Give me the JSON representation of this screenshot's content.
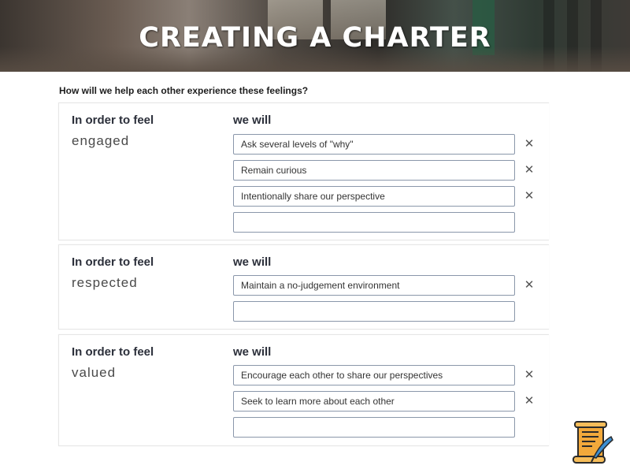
{
  "banner": {
    "title": "CREATING A CHARTER"
  },
  "question": "How will we help each other experience these feelings?",
  "cards": [
    {
      "feel_heading": "In order to feel",
      "feeling": "engaged",
      "will_heading": "we will",
      "entries": [
        "Ask several levels of \"why\"",
        "Remain curious",
        "Intentionally share our perspective",
        ""
      ]
    },
    {
      "feel_heading": "In order to feel",
      "feeling": "respected",
      "will_heading": "we will",
      "entries": [
        "Maintain a no-judgement environment",
        ""
      ]
    },
    {
      "feel_heading": "In order to feel",
      "feeling": "valued",
      "will_heading": "we will",
      "entries": [
        "Encourage each other to share our perspectives",
        "Seek to learn more about each other",
        ""
      ]
    }
  ],
  "icons": {
    "remove": "close-icon",
    "logo": "scroll-quill-icon"
  },
  "colors": {
    "banner_text": "#ffffff",
    "input_border": "#8a97aa",
    "logo_scroll": "#f0a93a",
    "logo_quill": "#3d8fd1"
  }
}
